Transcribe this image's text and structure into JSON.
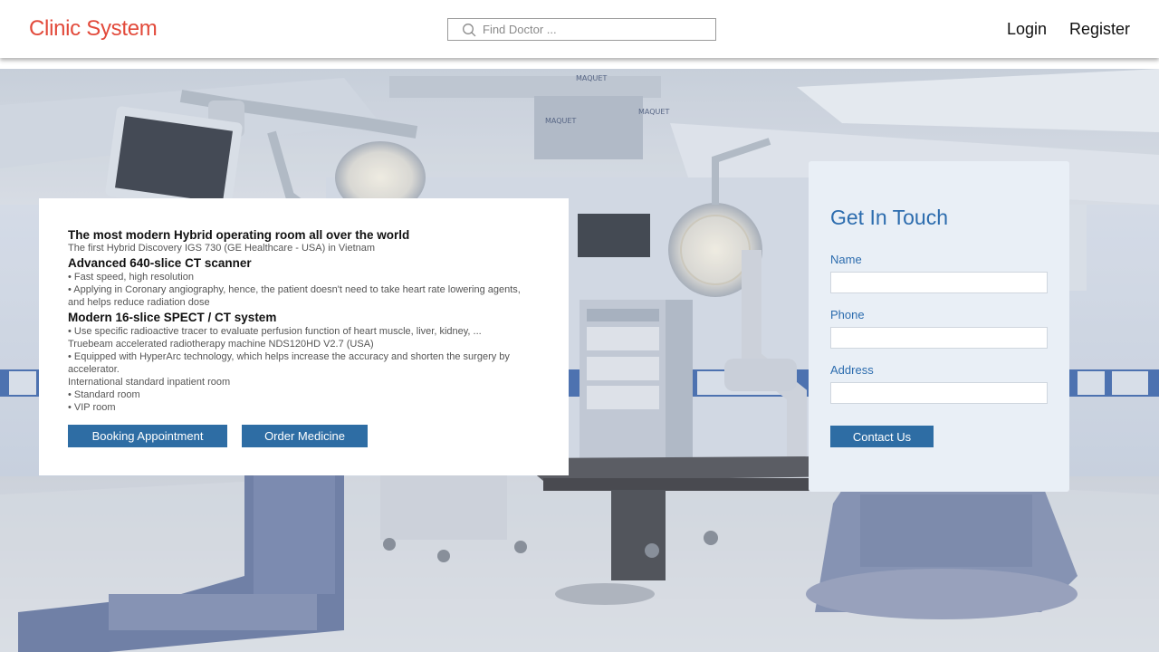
{
  "header": {
    "brand": "Clinic System",
    "search_placeholder": "Find Doctor ...",
    "nav": {
      "login": "Login",
      "register": "Register"
    }
  },
  "colors": {
    "brand": "#e24a3b",
    "accent": "#2e6da4",
    "contact_heading": "#2c6cae",
    "contact_bg": "#e9eff6"
  },
  "hero": {
    "scene": "hybrid-operating-room-photo",
    "equipment_brand_marks": [
      "MAQUET",
      "MAQUET",
      "MAQUET"
    ]
  },
  "info": {
    "blocks": [
      {
        "kind": "heading2",
        "text": "The most modern Hybrid operating room all over the world"
      },
      {
        "kind": "line",
        "text": "The first Hybrid Discovery IGS 730 (GE Healthcare - USA) in Vietnam"
      },
      {
        "kind": "heading3",
        "text": "Advanced 640-slice CT scanner"
      },
      {
        "kind": "line",
        "text": "• Fast speed, high resolution"
      },
      {
        "kind": "line",
        "text": "• Applying in Coronary angiography, hence, the patient doesn't need to take heart rate lowering agents, and helps reduce radiation dose"
      },
      {
        "kind": "heading3",
        "text": "Modern 16-slice SPECT / CT system"
      },
      {
        "kind": "line",
        "text": "• Use specific radioactive tracer to evaluate perfusion function of heart muscle, liver, kidney, ..."
      },
      {
        "kind": "line",
        "text": "Truebeam accelerated radiotherapy machine NDS120HD V2.7 (USA)"
      },
      {
        "kind": "line",
        "text": "• Equipped with HyperArc technology, which helps increase the accuracy and shorten the surgery by accelerator."
      },
      {
        "kind": "line",
        "text": "International standard inpatient room"
      },
      {
        "kind": "line",
        "text": "• Standard room"
      },
      {
        "kind": "line",
        "text": "• VIP room"
      }
    ],
    "buttons": {
      "booking": "Booking Appointment",
      "order": "Order Medicine"
    }
  },
  "contact": {
    "title": "Get In Touch",
    "fields": {
      "name": "Name",
      "phone": "Phone",
      "address": "Address"
    },
    "values": {
      "name": "",
      "phone": "",
      "address": ""
    },
    "submit": "Contact Us"
  }
}
